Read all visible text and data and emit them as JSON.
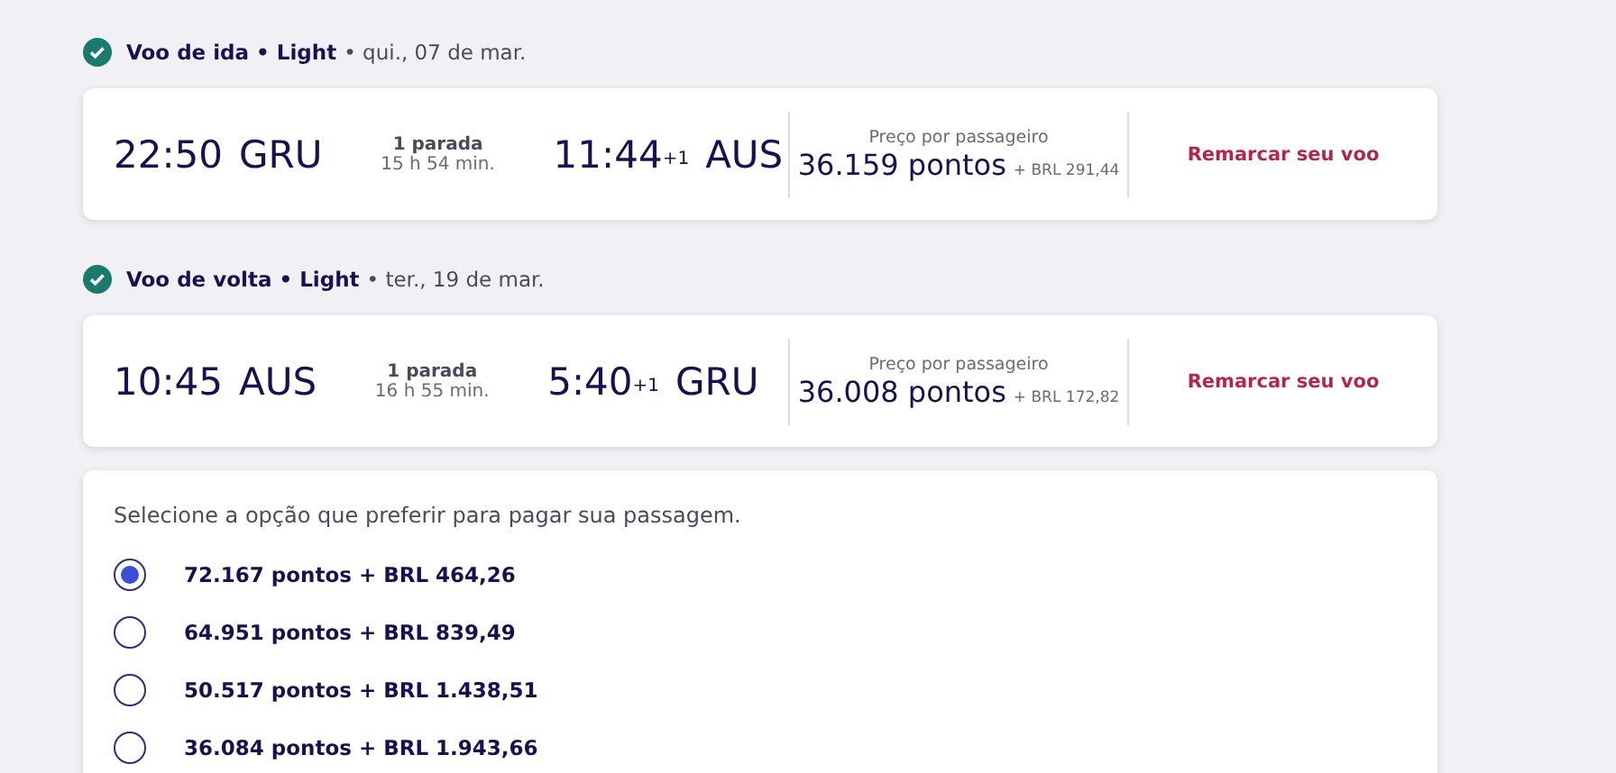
{
  "flights": [
    {
      "title": "Voo de ida • Light",
      "date": "• qui., 07 de mar.",
      "confirmed": true,
      "departure_time": "22:50",
      "departure_airport": "GRU",
      "stops": "1 parada",
      "duration": "15 h 54 min.",
      "arrival_time": "11:44",
      "day_offset": "+1",
      "arrival_airport": "AUS",
      "price_label": "Preço por passageiro",
      "points": "36.159 pontos",
      "money": "+ BRL 291,44",
      "action": "Remarcar seu voo"
    },
    {
      "title": "Voo de volta • Light",
      "date": "• ter., 19 de mar.",
      "confirmed": true,
      "departure_time": "10:45",
      "departure_airport": "AUS",
      "stops": "1 parada",
      "duration": "16 h 55 min.",
      "arrival_time": "5:40",
      "day_offset": "+1",
      "arrival_airport": "GRU",
      "price_label": "Preço por passageiro",
      "points": "36.008 pontos",
      "money": "+ BRL 172,82",
      "action": "Remarcar seu voo"
    }
  ],
  "payment": {
    "prompt": "Selecione a opção que preferir para pagar sua passagem.",
    "options": [
      {
        "label": "72.167 pontos + BRL 464,26",
        "selected": true
      },
      {
        "label": "64.951 pontos + BRL 839,49",
        "selected": false
      },
      {
        "label": "50.517 pontos + BRL 1.438,51",
        "selected": false
      },
      {
        "label": "36.084 pontos + BRL 1.943,66",
        "selected": false
      }
    ]
  }
}
